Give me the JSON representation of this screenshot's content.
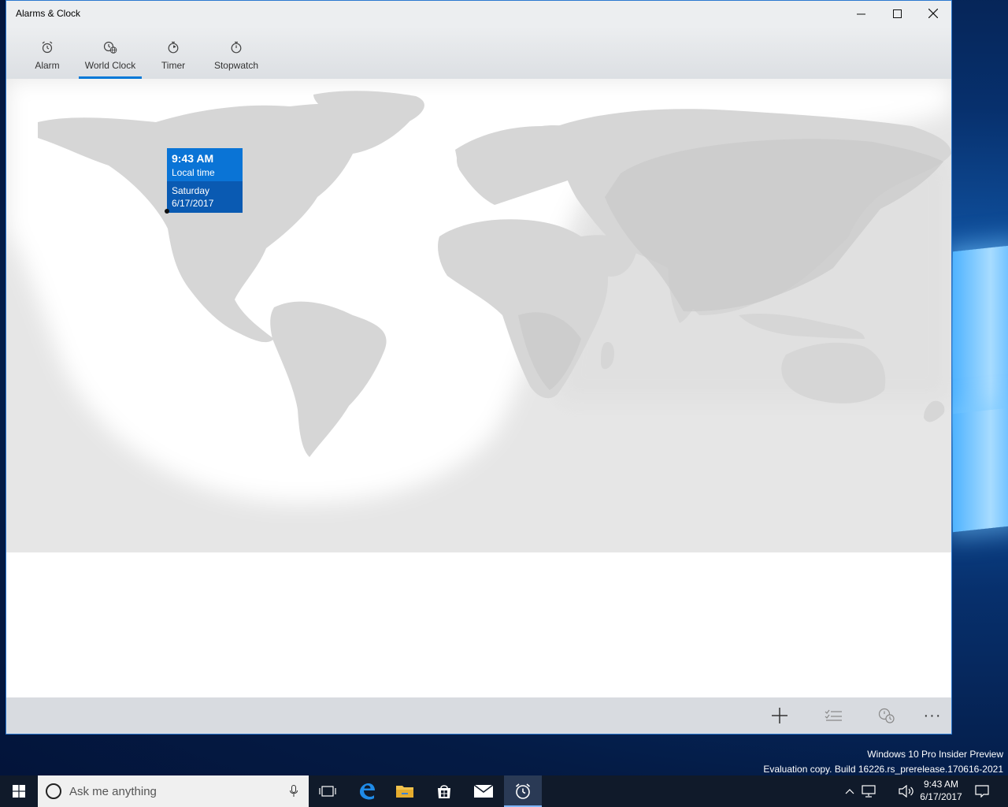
{
  "window": {
    "title": "Alarms & Clock",
    "minimize_icon": "minimize-icon",
    "maximize_icon": "maximize-icon",
    "close_icon": "close-icon"
  },
  "nav": {
    "tabs": [
      {
        "label": "Alarm",
        "icon": "alarm-clock-icon",
        "active": false
      },
      {
        "label": "World Clock",
        "icon": "world-clock-icon",
        "active": true
      },
      {
        "label": "Timer",
        "icon": "timer-icon",
        "active": false
      },
      {
        "label": "Stopwatch",
        "icon": "stopwatch-icon",
        "active": false
      }
    ]
  },
  "world_clock": {
    "local": {
      "time": "9:43 AM",
      "label": "Local time",
      "day": "Saturday",
      "date": "6/17/2017"
    }
  },
  "commands": {
    "add_icon": "plus-icon",
    "edit_icon": "select-list-icon",
    "compare_icon": "compare-clock-icon",
    "more_label": "···"
  },
  "desktop": {
    "watermark_line1": "Windows 10 Pro Insider Preview",
    "watermark_line2": "Evaluation copy. Build 16226.rs_prerelease.170616-2021"
  },
  "taskbar": {
    "search_placeholder": "Ask me anything",
    "clock_time": "9:43 AM",
    "clock_date": "6/17/2017"
  },
  "colors": {
    "accent": "#0078d7",
    "tooltip_top": "#0a74d6",
    "tooltip_bottom": "#0a5ab2",
    "land": "#d6d6d6",
    "night_land": "#c9c9c9"
  }
}
